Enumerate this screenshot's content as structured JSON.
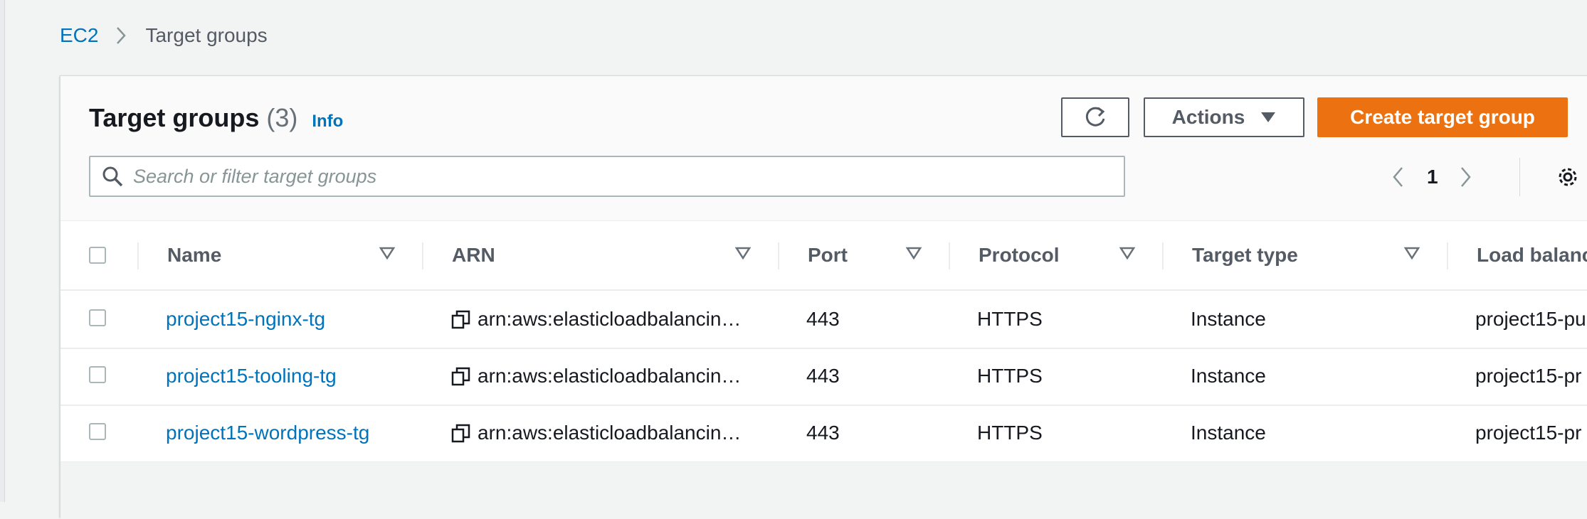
{
  "breadcrumb": {
    "root": "EC2",
    "current": "Target groups"
  },
  "header": {
    "title": "Target groups",
    "count": "(3)",
    "info": "Info"
  },
  "toolbar": {
    "actions_label": "Actions",
    "create_label": "Create target group"
  },
  "search": {
    "placeholder": "Search or filter target groups",
    "value": ""
  },
  "pagination": {
    "current_page": "1"
  },
  "table": {
    "columns": [
      "Name",
      "ARN",
      "Port",
      "Protocol",
      "Target type",
      "Load balanc"
    ],
    "rows": [
      {
        "name": "project15-nginx-tg",
        "arn": "arn:aws:elasticloadbalancin…",
        "port": "443",
        "protocol": "HTTPS",
        "target_type": "Instance",
        "load_balancer": "project15-pu"
      },
      {
        "name": "project15-tooling-tg",
        "arn": "arn:aws:elasticloadbalancin…",
        "port": "443",
        "protocol": "HTTPS",
        "target_type": "Instance",
        "load_balancer": "project15-pr"
      },
      {
        "name": "project15-wordpress-tg",
        "arn": "arn:aws:elasticloadbalancin…",
        "port": "443",
        "protocol": "HTTPS",
        "target_type": "Instance",
        "load_balancer": "project15-pr"
      }
    ]
  },
  "icons": {
    "breadcrumb_separator": "chevron-right-icon",
    "refresh": "refresh-icon",
    "actions_caret": "caret-down-icon",
    "search": "search-icon",
    "prev": "chevron-left-icon",
    "next": "chevron-right-icon",
    "settings": "gear-icon",
    "sort": "sort-triangle-icon",
    "copy": "copy-icon"
  },
  "colors": {
    "link": "#0073bb",
    "primary_button": "#ec7211",
    "background": "#f2f3f3",
    "text": "#16191f"
  }
}
